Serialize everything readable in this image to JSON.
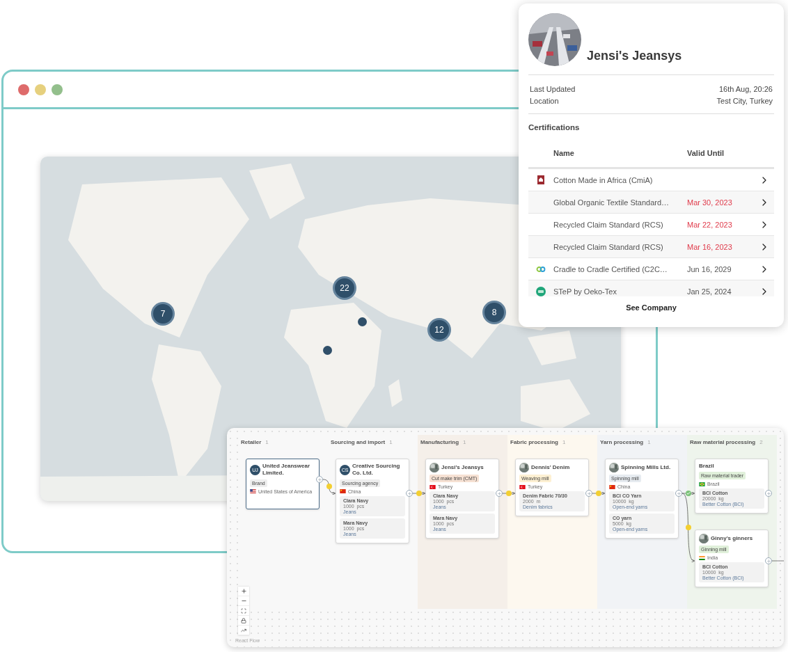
{
  "map": {
    "clusters": [
      {
        "count": "7"
      },
      {
        "count": "22"
      },
      {
        "count": "8"
      },
      {
        "count": "12"
      }
    ]
  },
  "company_card": {
    "name": "Jensi's Jeansys",
    "details": [
      {
        "label": "Last Updated",
        "value": "16th Aug, 20:26"
      },
      {
        "label": "Location",
        "value": "Test City, Turkey"
      }
    ],
    "certifications_title": "Certifications",
    "columns": [
      "Name",
      "Valid Until"
    ],
    "certifications": [
      {
        "kind": "logo",
        "name": "Cotton Made in Africa (CmiA)"
      },
      {
        "kind": "plain",
        "name": "Global Organic Textile Standard…",
        "valid_until": "Mar 30, 2023",
        "expired": true
      },
      {
        "kind": "plain",
        "name": "Recycled Claim Standard (RCS)",
        "valid_until": "Mar 22, 2023",
        "expired": true
      },
      {
        "kind": "plain",
        "name": "Recycled Claim Standard (RCS)",
        "valid_until": "Mar 16, 2023",
        "expired": true
      },
      {
        "kind": "logo",
        "name": "Cradle to Cradle Certified (C2C…",
        "valid_until": "Jun 16, 2029",
        "expired": false
      },
      {
        "kind": "logo",
        "name": "STeP by Oeko-Tex",
        "valid_until": "Jan 25, 2024",
        "expired": false
      }
    ],
    "link": "See Company"
  },
  "flow": {
    "stages": [
      {
        "title": "Retailer",
        "count": "1",
        "color": "#f8f8f8"
      },
      {
        "title": "Sourcing and import",
        "count": "1",
        "color": "#f8f8f8"
      },
      {
        "title": "Manufacturing",
        "count": "1",
        "color": "#f5efe9"
      },
      {
        "title": "Fabric processing",
        "count": "1",
        "color": "#fdf8ef"
      },
      {
        "title": "Yarn processing",
        "count": "1",
        "color": "#f1f3f6"
      },
      {
        "title": "Raw material processing",
        "count": "2",
        "color": "#eef4ec"
      }
    ],
    "nodes": [
      {
        "name": "United Jeanswear Limited.",
        "kind": "initials",
        "initials": "UJ",
        "role": "Brand",
        "color": "#eeeeee",
        "country": "United States of America",
        "selected": true
      },
      {
        "name": "Creative Sourcing Co. Ltd.",
        "kind": "initials",
        "initials": "CS",
        "role": "Sourcing agency",
        "color": "#eeeeee",
        "country": "China",
        "selected": false,
        "items": [
          {
            "name": "Clara Navy",
            "quantity": "1000  pcs",
            "category": "Jeans"
          },
          {
            "name": "Mara Navy",
            "quantity": "1000  pcs",
            "category": "Jeans"
          }
        ]
      },
      {
        "name": "Jensi's Jeansys",
        "role": "Cut make trim (CMT)",
        "color": "#f6e1d3",
        "country": "Turkey",
        "selected": false,
        "items": [
          {
            "name": "Clara Navy",
            "quantity": "1000  pcs",
            "category": "Jeans"
          },
          {
            "name": "Mara Navy",
            "quantity": "1000  pcs",
            "category": "Jeans"
          }
        ]
      },
      {
        "name": "Dennis' Denim",
        "role": "Weaving mill",
        "color": "#fdf0d2",
        "country": "Turkey",
        "selected": false,
        "items": [
          {
            "name": "Denim Fabric 70/30",
            "quantity": "2000  m",
            "category": "Denim fabrics"
          }
        ]
      },
      {
        "name": "Spinning Mills Ltd.",
        "role": "Spinning mill",
        "color": "#e6ebf0",
        "country": "China",
        "selected": false,
        "items": [
          {
            "name": "BCI CO Yarn",
            "quantity": "10000  kg",
            "category": "Open-end yarns"
          },
          {
            "name": "CO yarn",
            "quantity": "5000  kg",
            "category": "Open-end yarns"
          }
        ]
      },
      {
        "name": "Brazil",
        "kind": "plain",
        "role": "Raw material trader",
        "color": "#e0f0da",
        "country": "Brazil",
        "selected": false,
        "items": [
          {
            "name": "BCI Cotton",
            "quantity": "20000  kg",
            "category": "Better Cotton (BCI)"
          }
        ]
      },
      {
        "name": "Ginny's ginners",
        "role": "Ginning mill",
        "color": "#e0f0da",
        "country": "India",
        "selected": false,
        "items": [
          {
            "name": "BCI Cotton",
            "quantity": "10000  kg",
            "category": "Better Cotton (BCI)"
          }
        ]
      }
    ],
    "edges": [
      {
        "kind": "warning"
      },
      {
        "kind": "warning"
      },
      {
        "kind": "warning"
      },
      {
        "kind": "warning"
      },
      {
        "kind": "ok"
      },
      {
        "kind": "warning"
      },
      {
        "kind": "plain"
      }
    ],
    "attribution": "React Flow"
  }
}
